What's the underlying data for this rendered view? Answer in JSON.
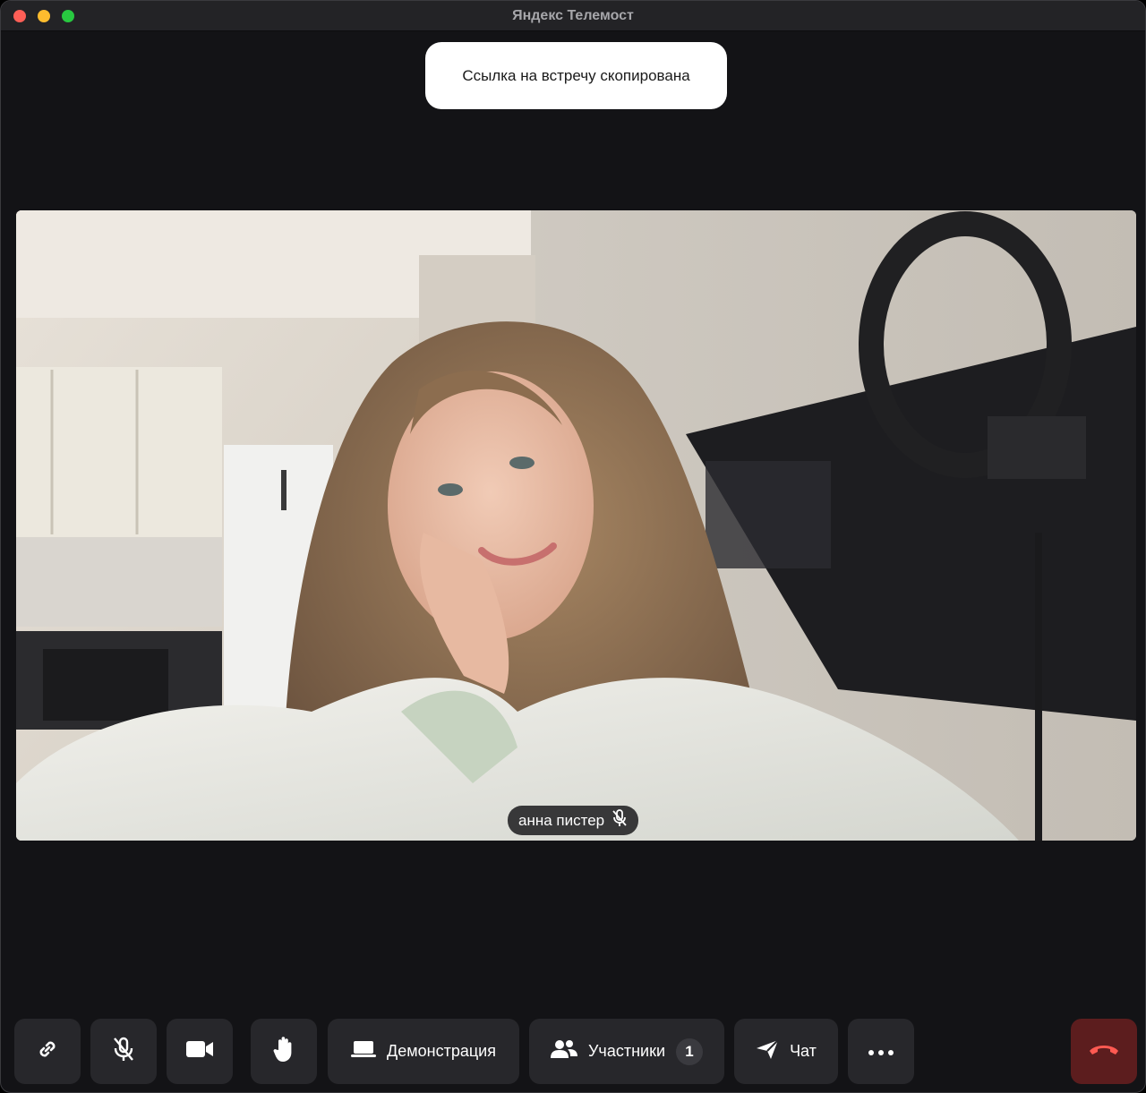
{
  "window": {
    "title": "Яндекс Телемост"
  },
  "toast": {
    "text": "Ссылка на встречу скопирована"
  },
  "participant": {
    "name": "анна пистер",
    "mic_icon": "mic-off-icon"
  },
  "toolbar": {
    "copy_link_icon": "link-icon",
    "mic_icon": "mic-off-icon",
    "camera_icon": "camera-icon",
    "raise_hand_icon": "hand-icon",
    "demo_label": "Демонстрация",
    "participants_label": "Участники",
    "participants_count": "1",
    "chat_label": "Чат",
    "more_icon": "ellipsis-icon",
    "end_call_icon": "phone-hangup-icon"
  },
  "colors": {
    "window_bg": "#131316",
    "button_bg": "#27272b",
    "end_call_bg": "#5c1d1e",
    "end_call_icon": "#ff5a52",
    "toast_bg": "#ffffff"
  }
}
